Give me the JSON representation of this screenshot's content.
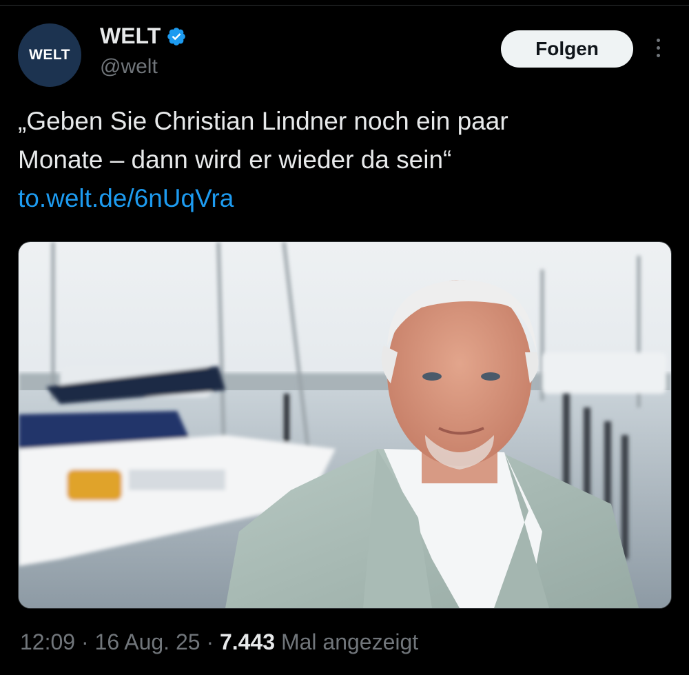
{
  "account": {
    "avatar_text": "WELT",
    "display_name": "WELT",
    "handle": "@welt",
    "verified_icon": "verified-badge-icon",
    "brand_color": "#1c3350"
  },
  "actions": {
    "follow_label": "Folgen",
    "more_icon": "more-vertical-icon"
  },
  "tweet": {
    "line1": "„Geben Sie Christian Lindner noch ein paar",
    "line2": "Monate – dann wird er wieder da sein“",
    "link": "to.welt.de/6nUqVra",
    "link_color": "#1d9bf0"
  },
  "media": {
    "type": "photo"
  },
  "meta": {
    "time": "12:09",
    "separator": "·",
    "date": "16 Aug. 25",
    "views_count": "7.443",
    "views_label": "Mal angezeigt"
  }
}
